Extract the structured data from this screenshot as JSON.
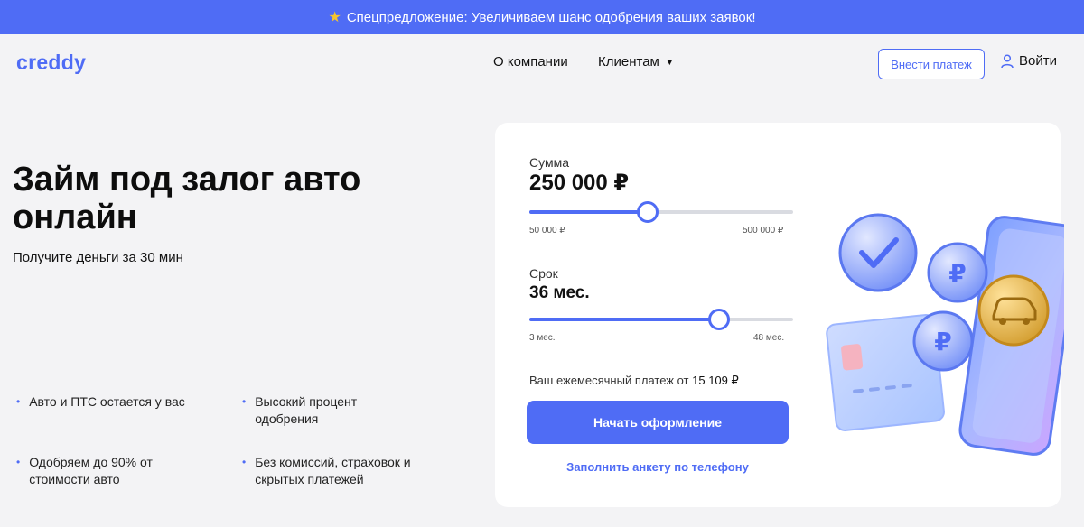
{
  "promo": {
    "star_icon": "star-icon",
    "text": "Спецпредложение: Увеличиваем шанс одобрения ваших заявок!",
    "star_color": "#f4c430",
    "bg_color": "#4f6cf5"
  },
  "header": {
    "logo": "creddy",
    "nav": {
      "about": "О компании",
      "clients": "Клиентам"
    },
    "pay_button": "Внести платеж",
    "login": "Войти"
  },
  "hero": {
    "title": "Займ под залог авто онлайн",
    "subtitle": "Получите деньги за 30 мин"
  },
  "features": [
    {
      "text": "Авто и ПТС остается у вас"
    },
    {
      "text": "Высокий процент одобрения"
    },
    {
      "text": "Одобряем до 90% от стоимости авто"
    },
    {
      "text": "Без комиссий, страховок и скрытых платежей"
    }
  ],
  "calculator": {
    "sum": {
      "label": "Сумма",
      "value": "250 000 ₽",
      "min": "50 000 ₽",
      "max": "500 000 ₽",
      "position": 0.45
    },
    "term": {
      "label": "Срок",
      "value": "36 мес.",
      "min": "3 мес.",
      "max": "48 мес.",
      "position": 0.72
    },
    "monthly_prefix": "Ваш ежемесячный платеж от",
    "monthly_value": "15 109 ₽",
    "cta": "Начать оформление",
    "phone_link": "Заполнить анкету по телефону"
  },
  "colors": {
    "accent": "#4f6cf5",
    "coin_gold": "#e9b94a"
  }
}
